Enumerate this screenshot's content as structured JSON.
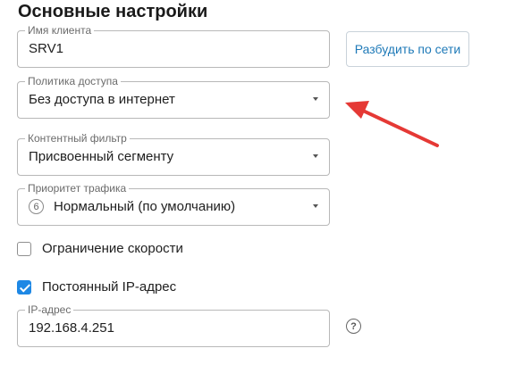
{
  "section_title": "Основные настройки",
  "client_name": {
    "label": "Имя клиента",
    "value": "SRV1"
  },
  "wake_button": "Разбудить по сети",
  "access_policy": {
    "label": "Политика доступа",
    "value": "Без доступа в интернет"
  },
  "content_filter": {
    "label": "Контентный фильтр",
    "value": "Присвоенный сегменту"
  },
  "traffic_priority": {
    "label": "Приоритет трафика",
    "icon_text": "6",
    "value": "Нормальный (по умолчанию)"
  },
  "speed_limit": {
    "label": "Ограничение скорости",
    "checked": false
  },
  "static_ip": {
    "label": "Постоянный IP-адрес",
    "checked": true
  },
  "ip_address": {
    "label": "IP-адрес",
    "value": "192.168.4.251"
  },
  "help_icon_text": "?",
  "colors": {
    "accent": "#1e88e5",
    "button_text": "#1f7ab8",
    "arrow": "#e53935"
  }
}
